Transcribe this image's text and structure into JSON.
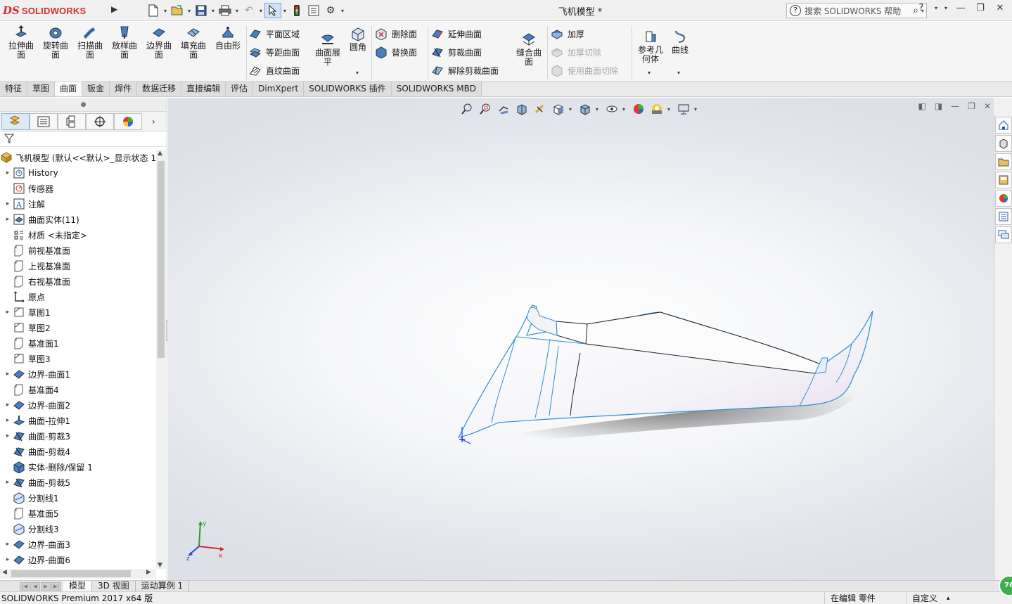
{
  "app": {
    "brand_ds": "DS",
    "brand_name": "SOLIDWORKS",
    "doc_title": "飞机模型 *",
    "help_search_placeholder": "搜索 SOLIDWORKS 帮助",
    "help_q": "?",
    "help_menu": "?"
  },
  "ribbon": {
    "big": [
      {
        "l1": "拉伸曲",
        "l2": "面"
      },
      {
        "l1": "旋转曲",
        "l2": "面"
      },
      {
        "l1": "扫描曲",
        "l2": "面"
      },
      {
        "l1": "放样曲",
        "l2": "面"
      },
      {
        "l1": "边界曲",
        "l2": "面"
      },
      {
        "l1": "填充曲",
        "l2": "面"
      },
      {
        "l1": "自由形",
        "l2": ""
      }
    ],
    "col1": [
      "平面区域",
      "等距曲面",
      "直纹曲面"
    ],
    "flatten": {
      "l1": "曲面展",
      "l2": "平"
    },
    "fillet": "圆角",
    "col2": [
      "删除面",
      "替换面"
    ],
    "col3": [
      "延伸曲面",
      "剪裁曲面",
      "解除剪裁曲面"
    ],
    "knit": {
      "l1": "缝合曲",
      "l2": "面"
    },
    "col4": [
      "加厚",
      "加厚切除",
      "使用曲面切除"
    ],
    "refgeo": {
      "l1": "参考几",
      "l2": "何体"
    },
    "curves": "曲线"
  },
  "tabs": [
    "特征",
    "草图",
    "曲面",
    "钣金",
    "焊件",
    "数据迁移",
    "直接编辑",
    "评估",
    "DimXpert",
    "SOLIDWORKS 插件",
    "SOLIDWORKS MBD"
  ],
  "active_tab": "曲面",
  "tree": {
    "root": "飞机模型 (默认<<默认>_显示状态 1",
    "items": [
      {
        "label": "History",
        "exp": "▸",
        "icon": "history-icon"
      },
      {
        "label": "传感器",
        "exp": "",
        "icon": "sensor-icon"
      },
      {
        "label": "注解",
        "exp": "▸",
        "icon": "annotation-icon"
      },
      {
        "label": "曲面实体(11)",
        "exp": "▸",
        "icon": "surface-bodies-icon"
      },
      {
        "label": "材质 <未指定>",
        "exp": "",
        "icon": "material-icon"
      },
      {
        "label": "前视基准面",
        "exp": "",
        "icon": "plane-icon"
      },
      {
        "label": "上视基准面",
        "exp": "",
        "icon": "plane-icon"
      },
      {
        "label": "右视基准面",
        "exp": "",
        "icon": "plane-icon"
      },
      {
        "label": "原点",
        "exp": "",
        "icon": "origin-icon"
      },
      {
        "label": "草图1",
        "exp": "▸",
        "icon": "sketch-icon"
      },
      {
        "label": "草图2",
        "exp": "",
        "icon": "sketch-icon"
      },
      {
        "label": "基准面1",
        "exp": "",
        "icon": "plane-icon"
      },
      {
        "label": "草图3",
        "exp": "",
        "icon": "sketch-icon"
      },
      {
        "label": "边界-曲面1",
        "exp": "▸",
        "icon": "boundary-surface-icon"
      },
      {
        "label": "基准面4",
        "exp": "",
        "icon": "plane-icon"
      },
      {
        "label": "边界-曲面2",
        "exp": "▸",
        "icon": "boundary-surface-icon"
      },
      {
        "label": "曲面-拉伸1",
        "exp": "▸",
        "icon": "extrude-surface-icon"
      },
      {
        "label": "曲面-剪裁3",
        "exp": "▸",
        "icon": "trim-surface-icon"
      },
      {
        "label": "曲面-剪裁4",
        "exp": "",
        "icon": "trim-surface-icon"
      },
      {
        "label": "实体-删除/保留 1",
        "exp": "",
        "icon": "delete-body-icon"
      },
      {
        "label": "曲面-剪裁5",
        "exp": "▸",
        "icon": "trim-surface-icon"
      },
      {
        "label": "分割线1",
        "exp": "",
        "icon": "split-line-icon"
      },
      {
        "label": "基准面5",
        "exp": "",
        "icon": "plane-icon"
      },
      {
        "label": "分割线3",
        "exp": "",
        "icon": "split-line-icon"
      },
      {
        "label": "边界-曲面3",
        "exp": "▸",
        "icon": "boundary-surface-icon"
      },
      {
        "label": "边界-曲面6",
        "exp": "▸",
        "icon": "boundary-surface-icon"
      }
    ]
  },
  "bottom_tabs": [
    "模型",
    "3D 视图",
    "运动算例 1"
  ],
  "status": {
    "product": "SOLIDWORKS Premium 2017 x64 版",
    "editing": "在编辑 零件",
    "units": "自定义",
    "badge": "76"
  },
  "triad_labels": {
    "x": "x",
    "y": "y",
    "z": "z"
  },
  "colors": {
    "brand": "#d62d2d",
    "model_edge": "#2f8fd0",
    "accent": "#2c7fd1"
  }
}
